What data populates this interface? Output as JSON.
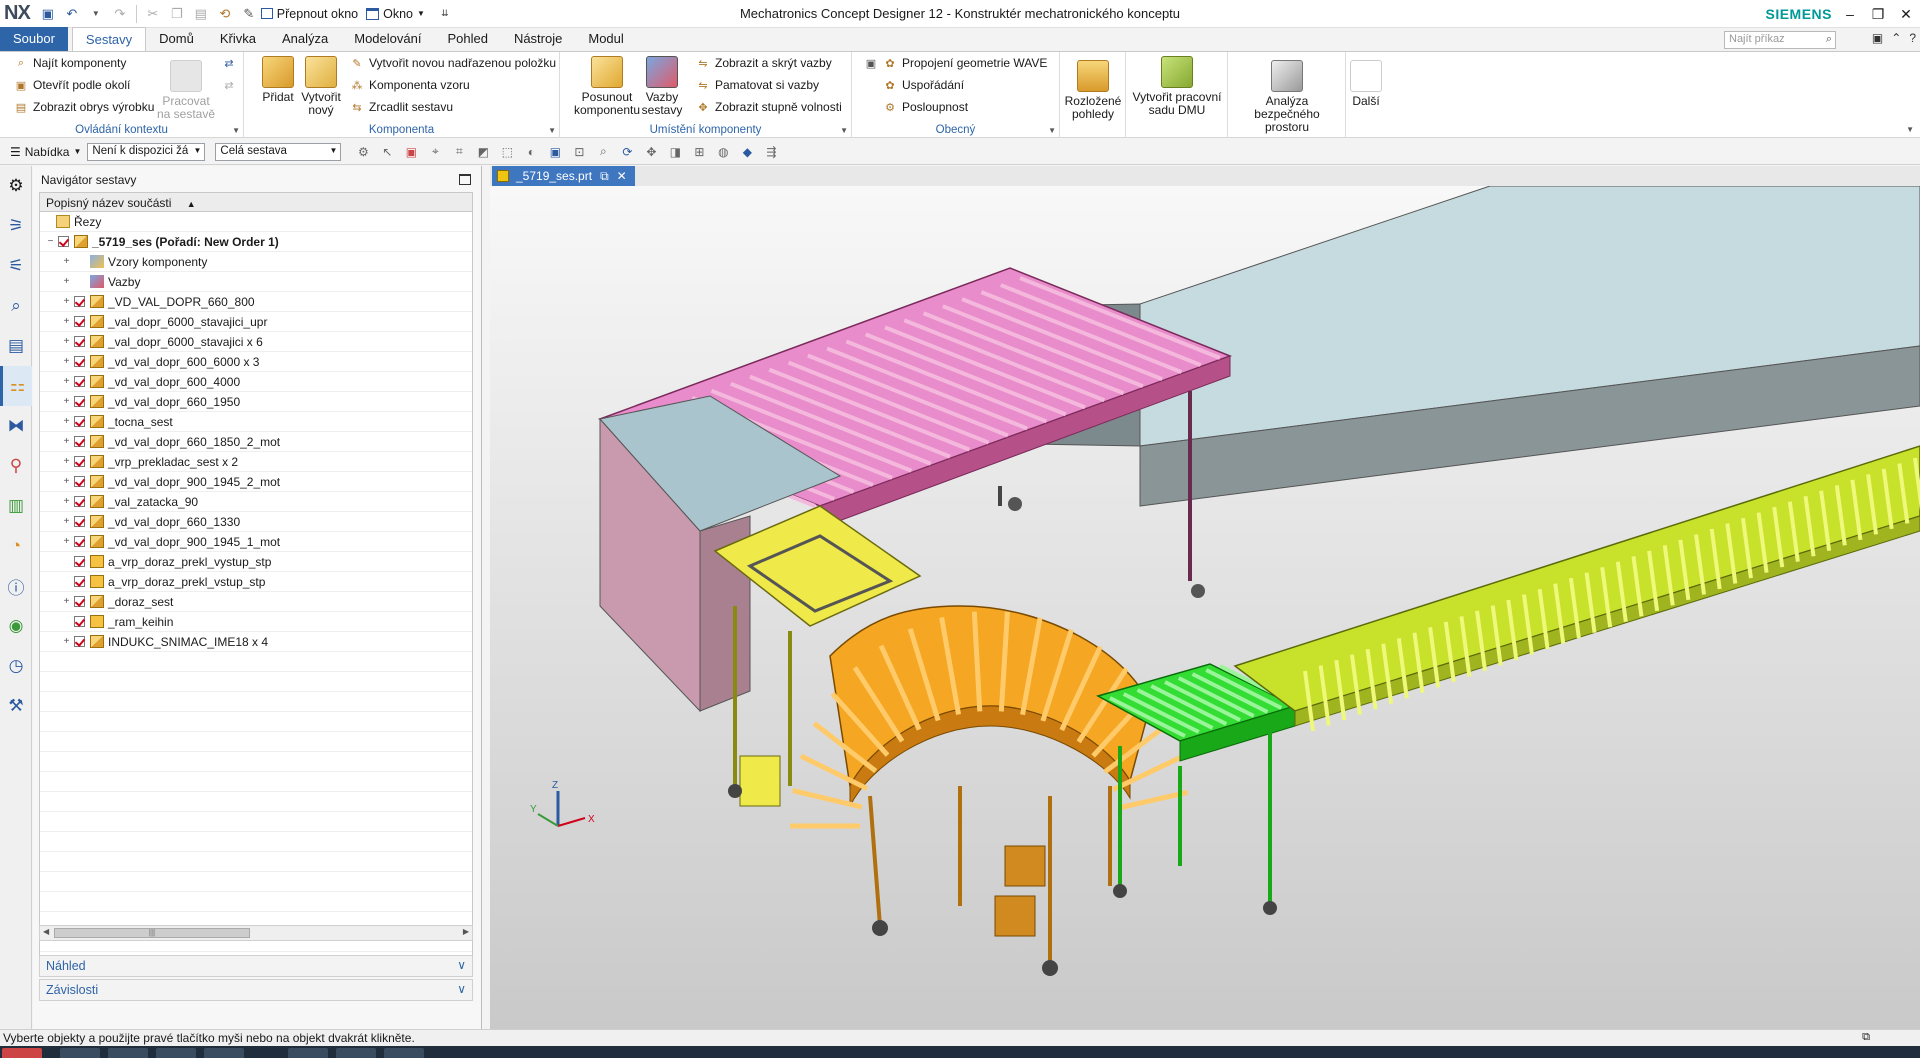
{
  "titlebar": {
    "logo": "NX",
    "switch_window": "Přepnout okno",
    "window_menu": "Okno",
    "app_title": "Mechatronics Concept Designer 12 - Konstruktér mechatronického konceptu",
    "brand": "SIEMENS"
  },
  "tabs": [
    {
      "label": "Soubor"
    },
    {
      "label": "Sestavy"
    },
    {
      "label": "Domů"
    },
    {
      "label": "Křivka"
    },
    {
      "label": "Analýza"
    },
    {
      "label": "Modelování"
    },
    {
      "label": "Pohled"
    },
    {
      "label": "Nástroje"
    },
    {
      "label": "Modul"
    }
  ],
  "search": {
    "placeholder": "Najít příkaz"
  },
  "ribbon": {
    "context": {
      "find": "Najít komponenty",
      "open_by_proximity": "Otevřít podle okolí",
      "show_outline": "Zobrazit obrys výrobku",
      "work_on_assembly_1": "Pracovat",
      "work_on_assembly_2": "na sestavě",
      "label": "Ovládání kontextu"
    },
    "component": {
      "add": "Přidat",
      "create_1": "Vytvořit",
      "create_2": "nový",
      "new_parent": "Vytvořit novou nadřazenou položku",
      "pattern": "Komponenta vzoru",
      "mirror": "Zrcadlit sestavu",
      "label": "Komponenta"
    },
    "position": {
      "move_1": "Posunout",
      "move_2": "komponentu",
      "constraints_1": "Vazby",
      "constraints_2": "sestavy",
      "show_hide": "Zobrazit a skrýt vazby",
      "remember": "Pamatovat si vazby",
      "dof": "Zobrazit stupně volnosti",
      "label": "Umístění komponenty"
    },
    "general": {
      "wave": "Propojení geometrie WAVE",
      "arrange": "Uspořádání",
      "sequence": "Posloupnost",
      "label": "Obecný"
    },
    "exploded_1": "Rozložené",
    "exploded_2": "pohledy",
    "dmu_1": "Vytvořit pracovní",
    "dmu_2": "sadu DMU",
    "clearance_1": "Analýza bezpečného",
    "clearance_2": "prostoru",
    "more": "Další"
  },
  "selbar": {
    "menu": "Nabídka",
    "filter": "Není k dispozici žá",
    "scope": "Celá sestava"
  },
  "navigator": {
    "title": "Navigátor sestavy",
    "column": "Popisný název součásti",
    "rows": [
      {
        "label": "Řezy",
        "level": 0,
        "type": "folder",
        "expand": false,
        "check": false
      },
      {
        "label": "_5719_ses (Pořadí: New Order 1)",
        "level": 0,
        "type": "asm",
        "expand": "minus",
        "check": true,
        "bold": true
      },
      {
        "label": "Vzory komponenty",
        "level": 1,
        "type": "pattern",
        "expand": "plus",
        "check": false
      },
      {
        "label": "Vazby",
        "level": 1,
        "type": "constraint",
        "expand": "plus",
        "check": false
      },
      {
        "label": "_VD_VAL_DOPR_660_800",
        "level": 1,
        "type": "asm",
        "expand": "plus",
        "check": true
      },
      {
        "label": "_val_dopr_6000_stavajici_upr",
        "level": 1,
        "type": "asm",
        "expand": "plus",
        "check": true
      },
      {
        "label": "_val_dopr_6000_stavajici x 6",
        "level": 1,
        "type": "asm",
        "expand": "plus",
        "check": true
      },
      {
        "label": "_vd_val_dopr_600_6000 x 3",
        "level": 1,
        "type": "asm",
        "expand": "plus",
        "check": true
      },
      {
        "label": "_vd_val_dopr_600_4000",
        "level": 1,
        "type": "asm",
        "expand": "plus",
        "check": true
      },
      {
        "label": "_vd_val_dopr_660_1950",
        "level": 1,
        "type": "asm",
        "expand": "plus",
        "check": true
      },
      {
        "label": "_tocna_sest",
        "level": 1,
        "type": "asm",
        "expand": "plus",
        "check": true
      },
      {
        "label": "_vd_val_dopr_660_1850_2_mot",
        "level": 1,
        "type": "asm",
        "expand": "plus",
        "check": true
      },
      {
        "label": "_vrp_prekladac_sest x 2",
        "level": 1,
        "type": "asm",
        "expand": "plus",
        "check": true
      },
      {
        "label": "_vd_val_dopr_900_1945_2_mot",
        "level": 1,
        "type": "asm",
        "expand": "plus",
        "check": true
      },
      {
        "label": "_val_zatacka_90",
        "level": 1,
        "type": "asm",
        "expand": "plus",
        "check": true
      },
      {
        "label": "_vd_val_dopr_660_1330",
        "level": 1,
        "type": "asm",
        "expand": "plus",
        "check": true
      },
      {
        "label": "_vd_val_dopr_900_1945_1_mot",
        "level": 1,
        "type": "asm",
        "expand": "plus",
        "check": true
      },
      {
        "label": "a_vrp_doraz_prekl_vystup_stp",
        "level": 1,
        "type": "part",
        "expand": false,
        "check": true
      },
      {
        "label": "a_vrp_doraz_prekl_vstup_stp",
        "level": 1,
        "type": "part",
        "expand": false,
        "check": true
      },
      {
        "label": "_doraz_sest",
        "level": 1,
        "type": "asm",
        "expand": "plus",
        "check": true
      },
      {
        "label": "_ram_keihin",
        "level": 1,
        "type": "part",
        "expand": false,
        "check": true
      },
      {
        "label": "INDUKC_SNIMAC_IME18 x 4",
        "level": 1,
        "type": "asm",
        "expand": "plus",
        "check": true
      }
    ],
    "scroll_thumb": "|||",
    "preview": "Náhled",
    "dependencies": "Závislosti"
  },
  "graphics": {
    "file_tab": "_5719_ses.prt"
  },
  "status": {
    "message": "Vyberte objekty a použijte pravé tlačítko myši nebo na objekt dvakrát klikněte."
  },
  "colors": {
    "accent": "#2e64a8",
    "pink": "#e46fb0",
    "yellow": "#e8e22a",
    "orange": "#f0a020",
    "green": "#22cc22",
    "lime": "#c8e12a",
    "box": "#c6dbe0"
  }
}
